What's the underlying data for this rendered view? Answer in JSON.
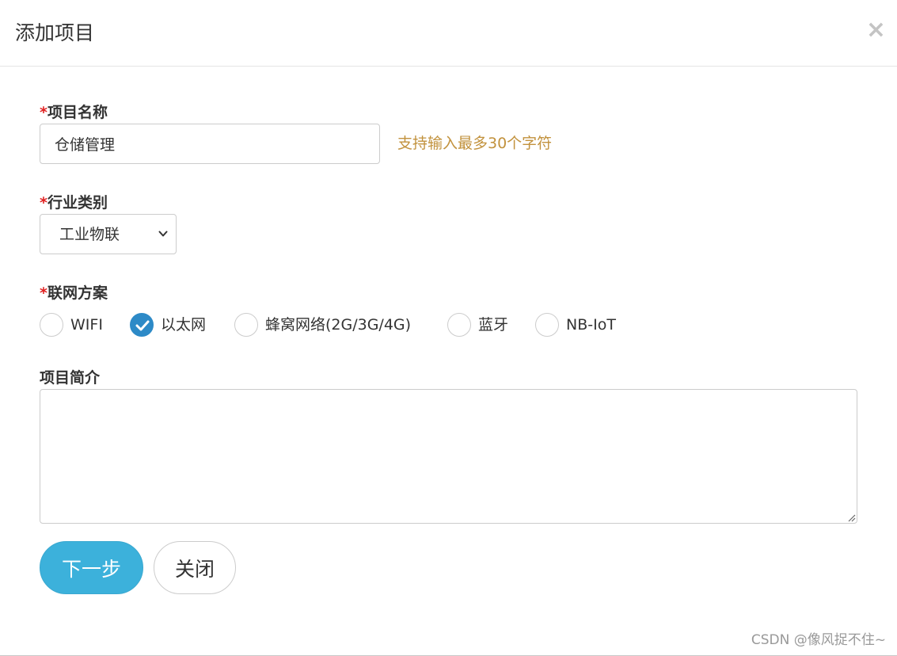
{
  "dialog": {
    "title": "添加项目",
    "close_symbol": "×"
  },
  "form": {
    "required_mark": "*",
    "project_name": {
      "label": "项目名称",
      "value": "仓储管理",
      "hint": "支持输入最多30个字符"
    },
    "industry": {
      "label": "行业类别",
      "selected": "工业物联"
    },
    "network": {
      "label": "联网方案",
      "options": [
        {
          "label": "WIFI",
          "checked": false
        },
        {
          "label": "以太网",
          "checked": true
        },
        {
          "label": "蜂窝网络(2G/3G/4G)",
          "checked": false
        },
        {
          "label": "蓝牙",
          "checked": false
        },
        {
          "label": "NB-IoT",
          "checked": false
        }
      ]
    },
    "description": {
      "label": "项目简介",
      "value": ""
    }
  },
  "buttons": {
    "next_label": "下一步",
    "close_label": "关闭"
  },
  "watermark": "CSDN @像风捉不住~",
  "colors": {
    "required": "#e02020",
    "hint": "#c2923d",
    "primary": "#3cb1db",
    "radio_checked": "#2d8ac7"
  }
}
